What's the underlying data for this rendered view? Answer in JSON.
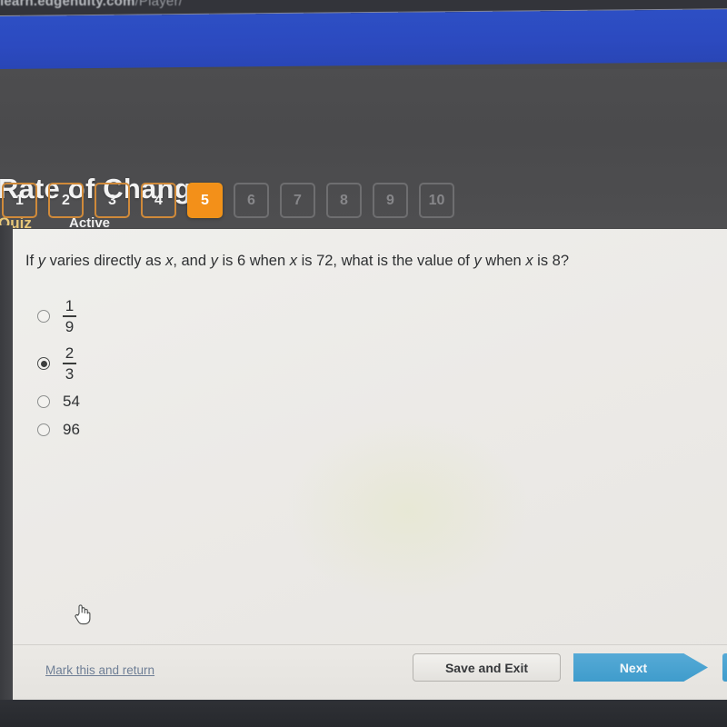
{
  "browser": {
    "url_bold": "learn.edgenuity.com",
    "url_rest": "/Player/"
  },
  "header": {
    "title": "Rate of Change",
    "kind": "Quiz",
    "state": "Active"
  },
  "pager": {
    "items": [
      {
        "label": "1",
        "state": "visited"
      },
      {
        "label": "2",
        "state": "visited"
      },
      {
        "label": "3",
        "state": "visited"
      },
      {
        "label": "4",
        "state": "visited"
      },
      {
        "label": "5",
        "state": "current"
      },
      {
        "label": "6",
        "state": "locked"
      },
      {
        "label": "7",
        "state": "locked"
      },
      {
        "label": "8",
        "state": "locked"
      },
      {
        "label": "9",
        "state": "locked"
      },
      {
        "label": "10",
        "state": "locked"
      }
    ]
  },
  "question": {
    "text": "If y varies directly as x, and y is 6 when x is 72, what is the value of y when x is 8?",
    "parts": [
      {
        "t": "If ",
        "italic": false
      },
      {
        "t": "y",
        "italic": true
      },
      {
        "t": " varies directly as ",
        "italic": false
      },
      {
        "t": "x",
        "italic": true
      },
      {
        "t": ", and ",
        "italic": false
      },
      {
        "t": "y",
        "italic": true
      },
      {
        "t": " is 6 when ",
        "italic": false
      },
      {
        "t": "x",
        "italic": true
      },
      {
        "t": " is 72, what is the value of ",
        "italic": false
      },
      {
        "t": "y",
        "italic": true
      },
      {
        "t": " when ",
        "italic": false
      },
      {
        "t": "x",
        "italic": true
      },
      {
        "t": " is 8?",
        "italic": false
      }
    ]
  },
  "options": [
    {
      "kind": "fraction",
      "numerator": "1",
      "denominator": "9",
      "label": "1/9",
      "selected": false
    },
    {
      "kind": "fraction",
      "numerator": "2",
      "denominator": "3",
      "label": "2/3",
      "selected": true
    },
    {
      "kind": "plain",
      "label": "54",
      "selected": false
    },
    {
      "kind": "plain",
      "label": "96",
      "selected": false
    }
  ],
  "footer": {
    "mark_link": "Mark this and return",
    "save_label": "Save and Exit",
    "next_label": "Next"
  },
  "colors": {
    "accent_orange": "#f39019",
    "banner_blue": "#2c4ac0",
    "next_blue": "#3f9ccc",
    "link_blue": "#6f7f96",
    "quiz_gold": "#e8c879",
    "header_gray": "#4a4a4c",
    "panel_bg": "#ecebe7"
  }
}
